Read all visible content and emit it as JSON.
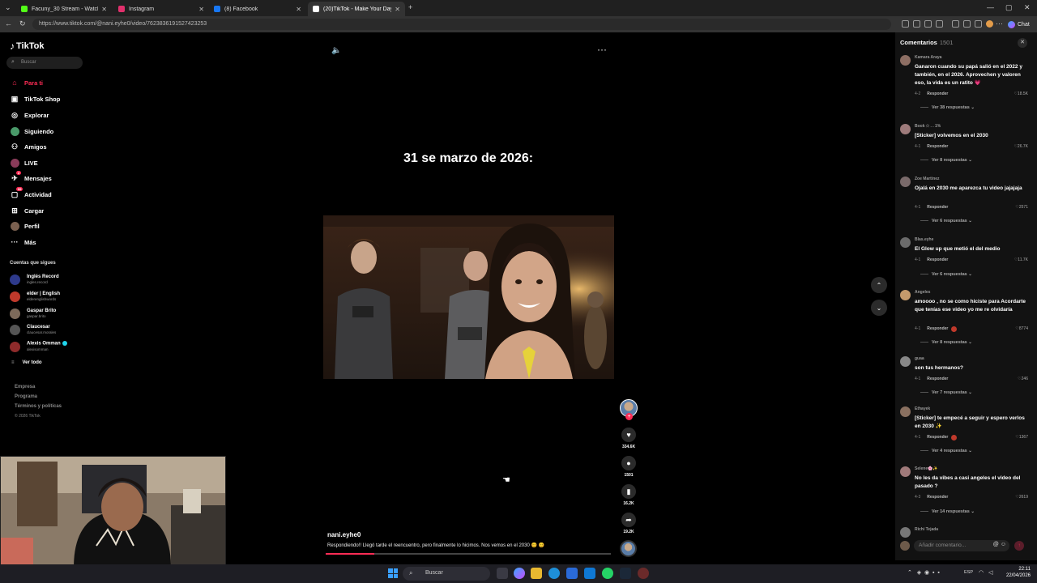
{
  "browser": {
    "tabs": [
      {
        "title": "Facuny_30 Stream - Watch Live o",
        "color": "#53fc18",
        "active": false
      },
      {
        "title": "Instagram",
        "color": "#e1306c",
        "active": false
      },
      {
        "title": "(8) Facebook",
        "color": "#1877f2",
        "active": false
      },
      {
        "title": "(20)TikTok - Make Your Day",
        "color": "#ffffff",
        "active": true
      }
    ],
    "new_tab": "+",
    "url": "https://www.tiktok.com/@nani.eyhe0/video/7623836191527423253",
    "chat_label": "Chat"
  },
  "sidebar": {
    "logo": "TikTok",
    "search_placeholder": "Buscar",
    "nav": [
      {
        "label": "Para ti",
        "icon": "home-icon",
        "glyph": "⌂",
        "active": true
      },
      {
        "label": "TikTok Shop",
        "icon": "shop-icon",
        "glyph": "🛍"
      },
      {
        "label": "Explorar",
        "icon": "compass-icon",
        "glyph": "◎"
      },
      {
        "label": "Siguiendo",
        "icon": "following-icon",
        "glyph": "●"
      },
      {
        "label": "Amigos",
        "icon": "friends-icon",
        "glyph": "👥"
      },
      {
        "label": "LIVE",
        "icon": "live-icon",
        "glyph": "●"
      },
      {
        "label": "Mensajes",
        "icon": "messages-icon",
        "glyph": "✉"
      },
      {
        "label": "Actividad",
        "icon": "activity-icon",
        "glyph": "▢"
      },
      {
        "label": "Cargar",
        "icon": "upload-icon",
        "glyph": "⊞"
      },
      {
        "label": "Perfil",
        "icon": "profile-icon",
        "glyph": "●"
      },
      {
        "label": "Más",
        "icon": "more-icon",
        "glyph": "···"
      }
    ],
    "following_title": "Cuentas que sigues",
    "following": [
      {
        "name": "Inglés Record",
        "handle": "ingles.record",
        "color": "#2e3a8c"
      },
      {
        "name": "elder | English",
        "handle": "elderenglishwords",
        "color": "#c0392b"
      },
      {
        "name": "Gaspar Brito",
        "handle": "gaspar.brito",
        "color": "#7d6a5a"
      },
      {
        "name": "Claucesar",
        "handle": "claucesar.morales",
        "color": "#555555"
      },
      {
        "name": "Alexis Omman",
        "handle": "alexisomman",
        "color": "#8e2b2b",
        "verified": true
      }
    ],
    "see_all": "Ver todo",
    "footer": [
      "Empresa",
      "Programa",
      "Términos y políticas",
      "© 2026 TikTok"
    ]
  },
  "video": {
    "overlay_caption": "31 se marzo de 2026:",
    "author": "nani.eyhe0",
    "description": "Respondiendo!! Llegó tarde el reencuentro, pero finalmente lo hicimos. Nos vemos en el 2030 😊 😊",
    "progress_fraction": 0.17,
    "actions": [
      {
        "name": "like",
        "glyph": "♥",
        "count": "334.6K"
      },
      {
        "name": "comment",
        "glyph": "●",
        "count": "1501"
      },
      {
        "name": "save",
        "glyph": "▮",
        "count": "16.2K"
      },
      {
        "name": "share",
        "glyph": "➦",
        "count": "19.2K"
      }
    ]
  },
  "comments": {
    "title": "Comentarios",
    "count": "1501",
    "input_placeholder": "Añadir comentario...",
    "items": [
      {
        "user": "Kamara Araya",
        "text": "Ganaron cuando su papá salió en el 2022 y también, en el 2026. Aprovechen y valoren eso, la vida es un ratito 💗",
        "date": "4-2",
        "likes": "18.5K",
        "replies": "Ver 38 respuestas",
        "color": "#8d6e63"
      },
      {
        "user": "Book ✩ . . 1%",
        "text": "[Sticker] volvemos en el 2030",
        "date": "4-1",
        "likes": "26.7K",
        "replies": "Ver 8 respuestas",
        "color": "#9e7b7b"
      },
      {
        "user": "Zoe Martinez",
        "text": "Ojalá en 2030 me aparezca tu video jajajaja",
        "date": "4-1",
        "likes": "2571",
        "replies": "Ver 6 respuestas",
        "color": "#7a6a6a"
      },
      {
        "user": "Blas.eyhe",
        "text": "El Glow up que metió el del medio",
        "date": "4-1",
        "likes": "11.7K",
        "replies": "Ver 6 respuestas",
        "color": "#6b6b6b"
      },
      {
        "user": "Angeles",
        "text": "amoooo , no se como hiciste para Acordarte que tenías ese video yo me re olvidaría",
        "date": "4-1",
        "likes": "8774",
        "replies": "Ver 8 respuestas",
        "color": "#c49a6c"
      },
      {
        "user": "guaa",
        "text": "son tus hermanos?",
        "date": "4-1",
        "likes": "246",
        "replies": "Ver 7 respuestas",
        "color": "#888888"
      },
      {
        "user": "Ethayek",
        "text": "[Sticker] te empecé a seguir y espero verlos en 2030 ✨",
        "date": "4-1",
        "likes": "1367",
        "replies": "Ver 4 respuestas",
        "color": "#8a7060"
      },
      {
        "user": "Selene🌸✨",
        "text": "No les da vibes a casi angeles el video del pasado ?",
        "date": "4-3",
        "likes": "2619",
        "replies": "Ver 14 respuestas",
        "color": "#a07a7a"
      },
      {
        "user": "Richi Tejada",
        "text": "",
        "date": "",
        "likes": "",
        "replies": "",
        "color": "#777777"
      }
    ],
    "reply_label": "Responder"
  },
  "taskbar": {
    "search_placeholder": "Buscar",
    "lang": "ESP",
    "time": "22:11",
    "date": "22/04/2026"
  }
}
